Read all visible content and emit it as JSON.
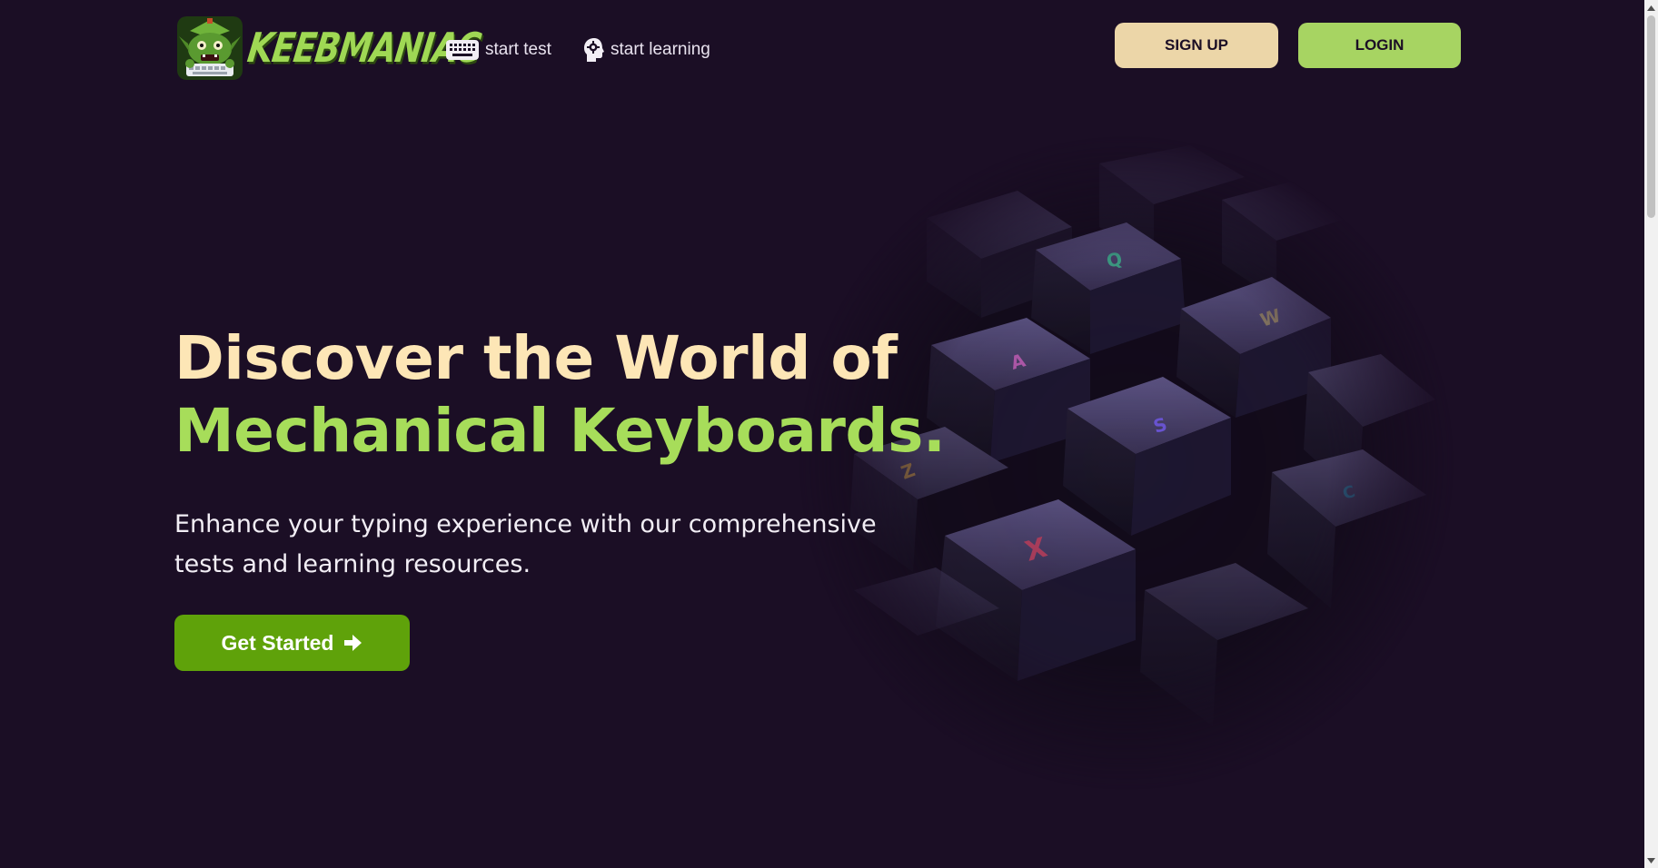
{
  "brand": {
    "name": "KEEBMANIAC",
    "logo_icon": "goblin-mascot-icon"
  },
  "nav": {
    "links": [
      {
        "label": "start test",
        "icon": "keyboard-icon"
      },
      {
        "label": "start learning",
        "icon": "brain-gear-icon"
      }
    ],
    "signup_label": "SIGN UP",
    "login_label": "LOGIN"
  },
  "hero": {
    "headline_line1": "Discover the World of",
    "headline_line2": "Mechanical Keyboards.",
    "subtext": "Enhance your typing experience with our comprehensive tests and learning resources.",
    "cta_label": "Get Started",
    "cta_icon": "arrow-right-icon",
    "image_icon": "mechanical-keyboard-keys-image",
    "keycap_letters": [
      "Q",
      "W",
      "A",
      "S",
      "Z",
      "X"
    ]
  },
  "colors": {
    "background": "#1b0e25",
    "headline_cream": "#fde6b6",
    "headline_green": "#a7dd5a",
    "signup_button": "#ecd6a8",
    "login_button": "#a7d462",
    "cta_button": "#5fa20a",
    "brand_green": "#9fd854"
  }
}
